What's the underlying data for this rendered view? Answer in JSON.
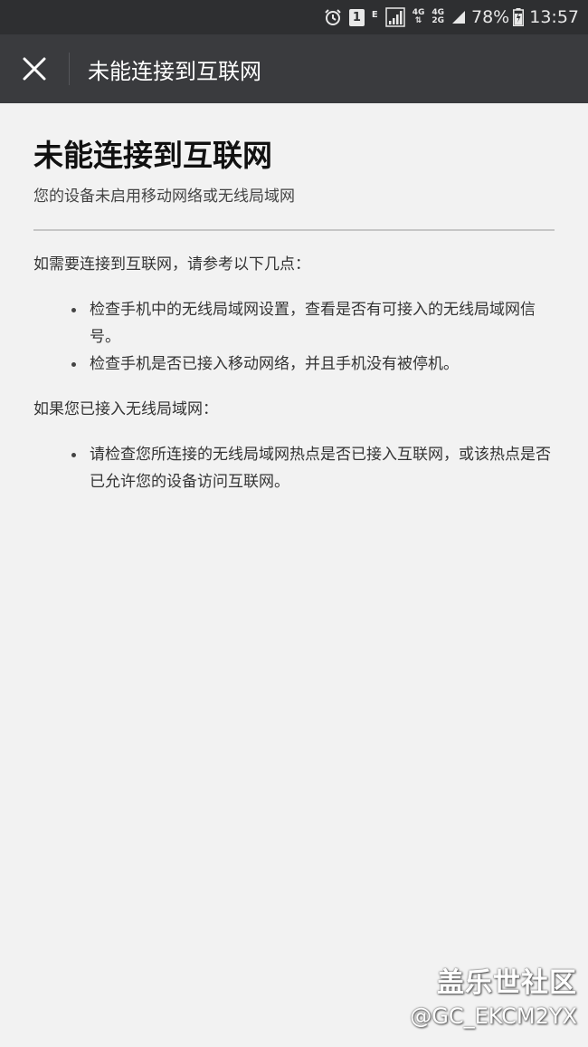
{
  "status_bar": {
    "network_e": "E",
    "net_4g_a": "4G",
    "net_4g_b": "4G",
    "net_2g": "2G",
    "notif_badge": "1",
    "battery": "78%",
    "time": "13:57"
  },
  "app_bar": {
    "title": "未能连接到互联网"
  },
  "content": {
    "title": "未能连接到互联网",
    "subtitle": "您的设备未启用移动网络或无线局域网",
    "intro": "如需要连接到互联网，请参考以下几点：",
    "tips": [
      "检查手机中的无线局域网设置，查看是否有可接入的无线局域网信号。",
      "检查手机是否已接入移动网络，并且手机没有被停机。"
    ],
    "wifi_intro": "如果您已接入无线局域网：",
    "wifi_tips": [
      "请检查您所连接的无线局域网热点是否已接入互联网，或该热点是否已允许您的设备访问互联网。"
    ]
  },
  "watermark": {
    "line1": "盖乐世社区",
    "line2": "@GC_EKCM2YX"
  }
}
